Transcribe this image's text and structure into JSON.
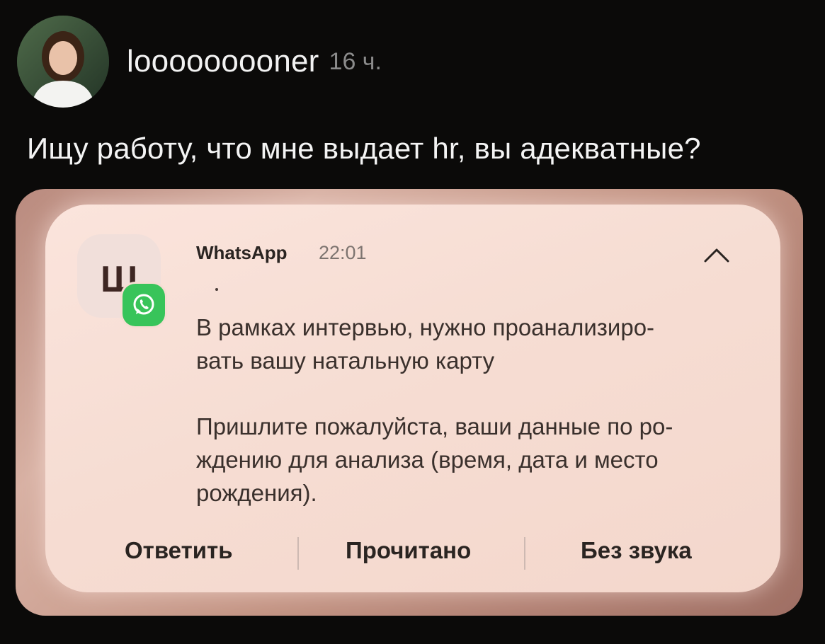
{
  "post": {
    "username": "looooooooner",
    "time_ago": "16 ч.",
    "text": "Ищу работу, что мне выдает hr, вы адекватные?"
  },
  "notification": {
    "app_icon_letter": "Ш",
    "app_name": "WhatsApp",
    "time": "22:01",
    "sender": ".",
    "message_lines_1": [
      "В рамках интервью, нужно проанализиро-",
      "вать вашу натальную карту"
    ],
    "message_lines_2": [
      "Пришлите пожалуйста, ваши данные по ро-",
      "ждению для анализа (время, дата и место",
      "рождения)."
    ],
    "actions": {
      "reply": "Ответить",
      "mark_read": "Прочитано",
      "mute": "Без звука"
    }
  },
  "colors": {
    "background": "#0b0a09",
    "card": "#f6ddd3",
    "whatsapp_green": "#38c45a"
  },
  "icons": [
    "user-avatar",
    "whatsapp-icon",
    "chevron-up-icon"
  ]
}
